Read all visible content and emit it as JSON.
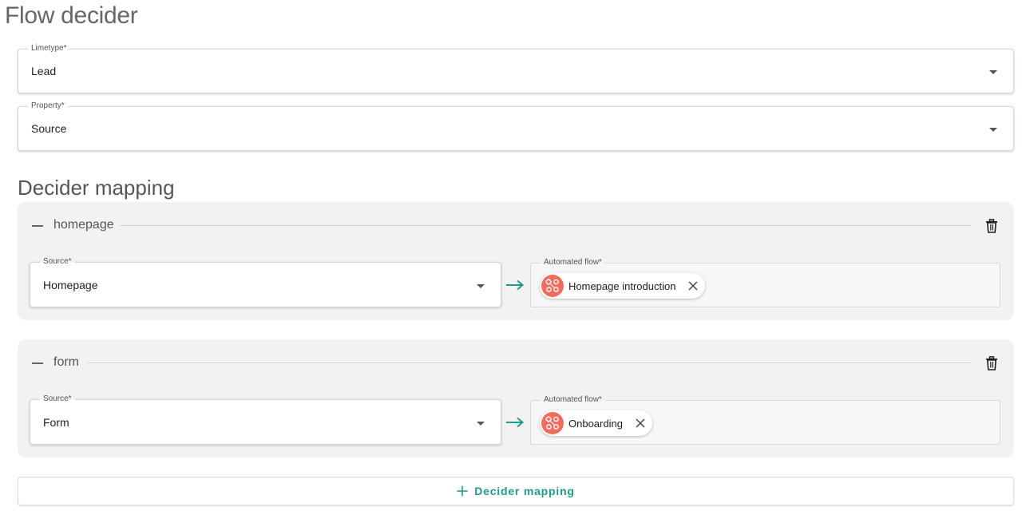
{
  "page": {
    "title": "Flow decider"
  },
  "limetype": {
    "label": "Limetype*",
    "value": "Lead"
  },
  "property": {
    "label": "Property*",
    "value": "Source"
  },
  "decider_mapping": {
    "title": "Decider mapping",
    "mappings": [
      {
        "name": "homepage",
        "source_label": "Source*",
        "source_value": "Homepage",
        "flow_label": "Automated flow*",
        "flow_chip": "Homepage introduction"
      },
      {
        "name": "form",
        "source_label": "Source*",
        "source_value": "Form",
        "flow_label": "Automated flow*",
        "flow_chip": "Onboarding"
      }
    ],
    "add_button_label": "Decider mapping"
  },
  "icons": {
    "collapse": "minus-icon",
    "delete": "trash-icon",
    "arrow": "arrow-right-icon",
    "flow": "flow-icon",
    "remove": "close-icon",
    "add": "plus-icon",
    "dropdown": "caret-down-icon"
  },
  "colors": {
    "accent": "#1f9a8f",
    "chip_avatar": "#f26b5b",
    "card_background": "#f2f2f2"
  }
}
